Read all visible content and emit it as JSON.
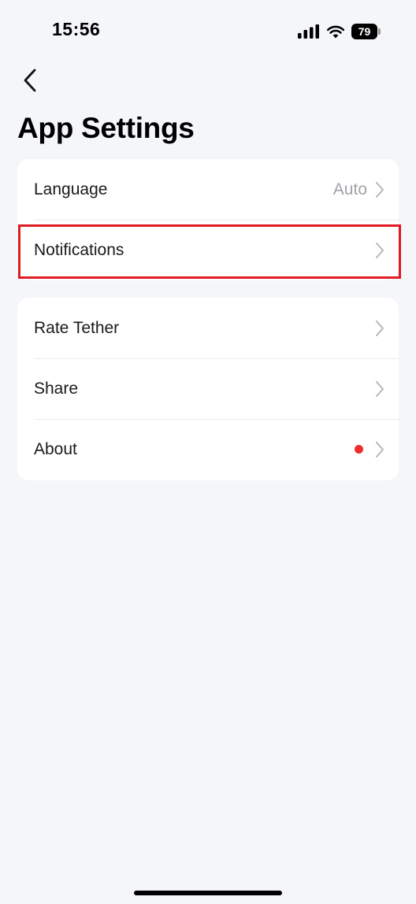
{
  "status_bar": {
    "time": "15:56",
    "battery": "79",
    "icons": [
      "signal-icon",
      "wifi-icon",
      "battery-icon"
    ]
  },
  "nav": {
    "back_icon": "chevron-left-icon"
  },
  "page": {
    "title": "App Settings"
  },
  "groups": [
    {
      "items": [
        {
          "label": "Language",
          "value": "Auto"
        },
        {
          "label": "Notifications",
          "value": ""
        }
      ]
    },
    {
      "items": [
        {
          "label": "Rate Tether",
          "value": ""
        },
        {
          "label": "Share",
          "value": ""
        },
        {
          "label": "About",
          "value": "",
          "badge": "red-dot-icon"
        }
      ]
    }
  ],
  "colors": {
    "background": "#f5f6fa",
    "card": "#ffffff",
    "value_text": "#a3a3a8",
    "badge": "#ef2d2d",
    "highlight": "#e01b24"
  }
}
